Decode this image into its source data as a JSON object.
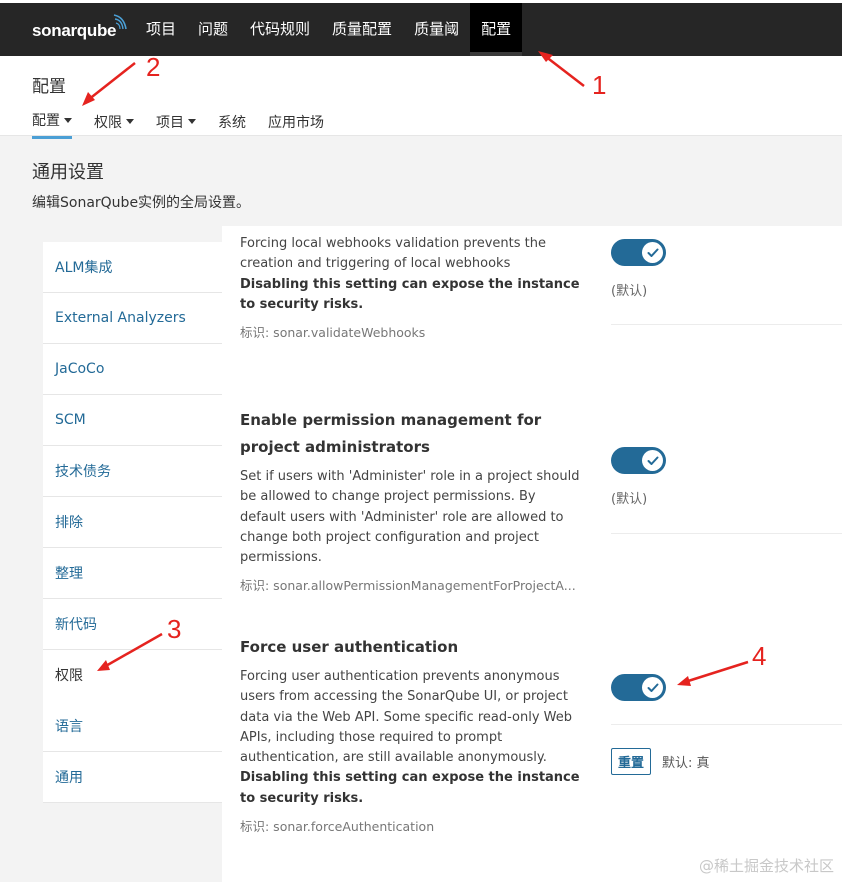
{
  "topbar": {
    "logo": "sonarqube",
    "nav": [
      "项目",
      "问题",
      "代码规则",
      "质量配置",
      "质量阈",
      "配置"
    ]
  },
  "header": {
    "title": "配置",
    "subnav": [
      "配置",
      "权限",
      "项目",
      "系统",
      "应用市场"
    ]
  },
  "section": {
    "title": "通用设置",
    "description": "编辑SonarQube实例的全局设置。"
  },
  "sidebar": {
    "items": [
      "ALM集成",
      "External Analyzers",
      "JaCoCo",
      "SCM",
      "技术债务",
      "排除",
      "整理",
      "新代码",
      "权限",
      "语言",
      "通用"
    ],
    "active_index": 8
  },
  "settings": [
    {
      "description": "Forcing local webhooks validation prevents the creation and triggering of local webhooks",
      "warning": "Disabling this setting can expose the instance to security risks.",
      "key": "标识: sonar.validateWebhooks",
      "enabled": true,
      "default_note": "(默认)"
    },
    {
      "title": "Enable permission management for project administrators",
      "description": "Set if users with 'Administer' role in a project should be allowed to change project permissions. By default users with 'Administer' role are allowed to change both project configuration and project permissions.",
      "key": "标识: sonar.allowPermissionManagementForProjectA...",
      "enabled": true,
      "default_note": "(默认)"
    },
    {
      "title": "Force user authentication",
      "description": "Forcing user authentication prevents anonymous users from accessing the SonarQube UI, or project data via the Web API. Some specific read-only Web APIs, including those required to prompt authentication, are still available anonymously.",
      "warning": "Disabling this setting can expose the instance to security risks.",
      "key": "标识: sonar.forceAuthentication",
      "enabled": true,
      "reset_label": "重置",
      "default_value": "默认: 真"
    }
  ],
  "annotations": [
    "1",
    "2",
    "3",
    "4"
  ],
  "watermark": "@稀土掘金技术社区",
  "colors": {
    "topbar": "#262626",
    "accent": "#236a97",
    "tab_underline": "#4b9fd5",
    "annotation": "#e5231f"
  }
}
